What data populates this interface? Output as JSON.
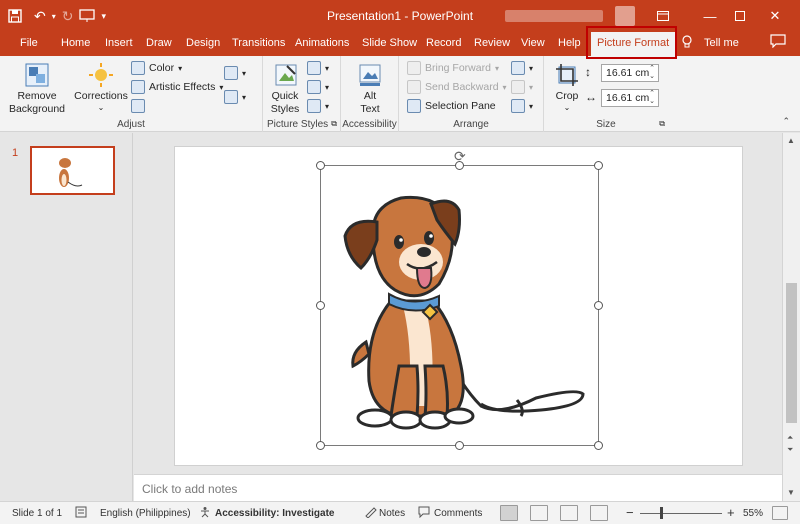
{
  "titlebar": {
    "title": "Presentation1  -  PowerPoint",
    "qat": {
      "save_icon": "save-icon",
      "undo_icon": "undo-icon",
      "redo_icon": "redo-icon",
      "present_icon": "present-icon",
      "customize_icon": "customize-icon"
    },
    "window_buttons": [
      "ribbon-display-icon",
      "minimize-icon",
      "maximize-icon",
      "close-icon"
    ]
  },
  "tabs": {
    "items": [
      "File",
      "Home",
      "Insert",
      "Draw",
      "Design",
      "Transitions",
      "Animations",
      "Slide Show",
      "Record",
      "Review",
      "View",
      "Help"
    ],
    "active": "Picture Format",
    "tell_me": "Tell me"
  },
  "ribbon": {
    "adjust": {
      "label": "Adjust",
      "remove_background": "Remove\nBackground",
      "corrections": "Corrections",
      "color": "Color",
      "artistic_effects": "Artistic Effects"
    },
    "picture_styles": {
      "label": "Picture Styles",
      "quick_styles": "Quick\nStyles"
    },
    "accessibility": {
      "label": "Accessibility",
      "alt_text": "Alt\nText"
    },
    "arrange": {
      "label": "Arrange",
      "bring_forward": "Bring Forward",
      "send_backward": "Send Backward",
      "selection_pane": "Selection Pane"
    },
    "size": {
      "label": "Size",
      "crop": "Crop",
      "height": "16.61 cm",
      "width": "16.61 cm"
    }
  },
  "thumbnails": {
    "slide_number": "1"
  },
  "notes": {
    "placeholder": "Click to add notes"
  },
  "status": {
    "slide": "Slide 1 of 1",
    "language": "English (Philippines)",
    "accessibility": "Accessibility: Investigate",
    "notes": "Notes",
    "comments": "Comments",
    "minus": "−",
    "plus": "+",
    "zoom": "55%"
  },
  "colors": {
    "accent": "#c43e1c",
    "highlight_border": "#c00000"
  }
}
